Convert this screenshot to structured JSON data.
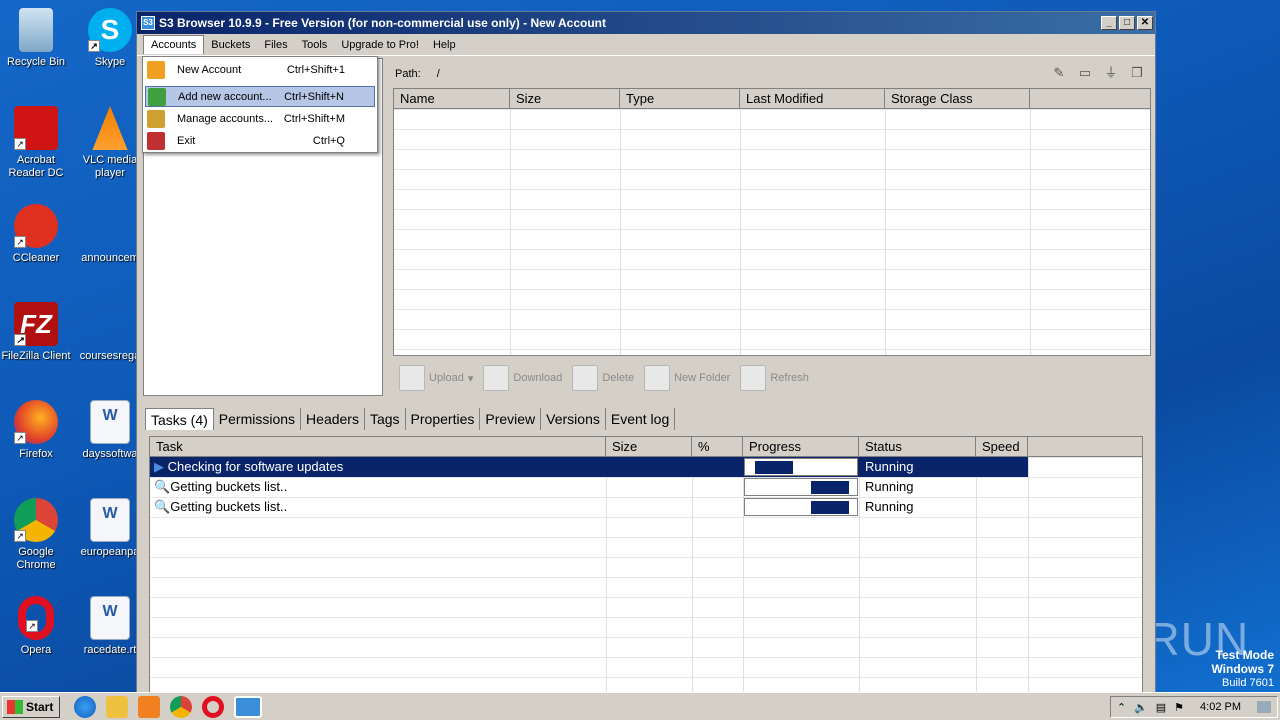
{
  "desktop": {
    "icons": [
      {
        "label": "Recycle Bin"
      },
      {
        "label": "Skype"
      },
      {
        "label": "Acrobat Reader DC"
      },
      {
        "label": "VLC media player"
      },
      {
        "label": "CCleaner"
      },
      {
        "label": "announcem"
      },
      {
        "label": "FileZilla Client"
      },
      {
        "label": "coursesrega"
      },
      {
        "label": "Firefox"
      },
      {
        "label": "dayssoftwa"
      },
      {
        "label": "Google Chrome"
      },
      {
        "label": "europeanpa"
      },
      {
        "label": "Opera"
      },
      {
        "label": "racedate.rt"
      }
    ],
    "watermark": "ANY RUN",
    "test_mode": {
      "line1": "Test Mode",
      "line2": "Windows 7",
      "line3": "Build 7601"
    }
  },
  "window": {
    "title": "S3 Browser 10.9.9 - Free Version (for non-commercial use only) - New Account",
    "app_icon_text": "S3",
    "menu": [
      "Accounts",
      "Buckets",
      "Files",
      "Tools",
      "Upgrade to Pro!",
      "Help"
    ],
    "dropdown": [
      {
        "label": "New Account",
        "shortcut": "Ctrl+Shift+1",
        "color": "#f0a020"
      },
      {
        "label": "Add new account...",
        "shortcut": "Ctrl+Shift+N",
        "color": "#40a040"
      },
      {
        "label": "Manage accounts...",
        "shortcut": "Ctrl+Shift+M",
        "color": "#d0a030"
      },
      {
        "label": "Exit",
        "shortcut": "Ctrl+Q",
        "color": "#c03030"
      }
    ],
    "path": {
      "label": "Path:",
      "value": "/"
    },
    "file_columns": [
      "Name",
      "Size",
      "Type",
      "Last Modified",
      "Storage Class"
    ],
    "actions": [
      "Upload",
      "Download",
      "Delete",
      "New Folder",
      "Refresh"
    ],
    "tabs": [
      "Tasks (4)",
      "Permissions",
      "Headers",
      "Tags",
      "Properties",
      "Preview",
      "Versions",
      "Event log"
    ],
    "task_columns": [
      "Task",
      "Size",
      "%",
      "Progress",
      "Status",
      "Speed"
    ],
    "tasks": [
      {
        "task": "Checking for software updates",
        "status": "Running",
        "progress": 0.35
      },
      {
        "task": "Getting buckets list..",
        "status": "Running",
        "progress": 0.35
      },
      {
        "task": "Getting buckets list..",
        "status": "Running",
        "progress": 0.35
      }
    ]
  },
  "taskbar": {
    "start": "Start",
    "clock": "4:02 PM"
  }
}
